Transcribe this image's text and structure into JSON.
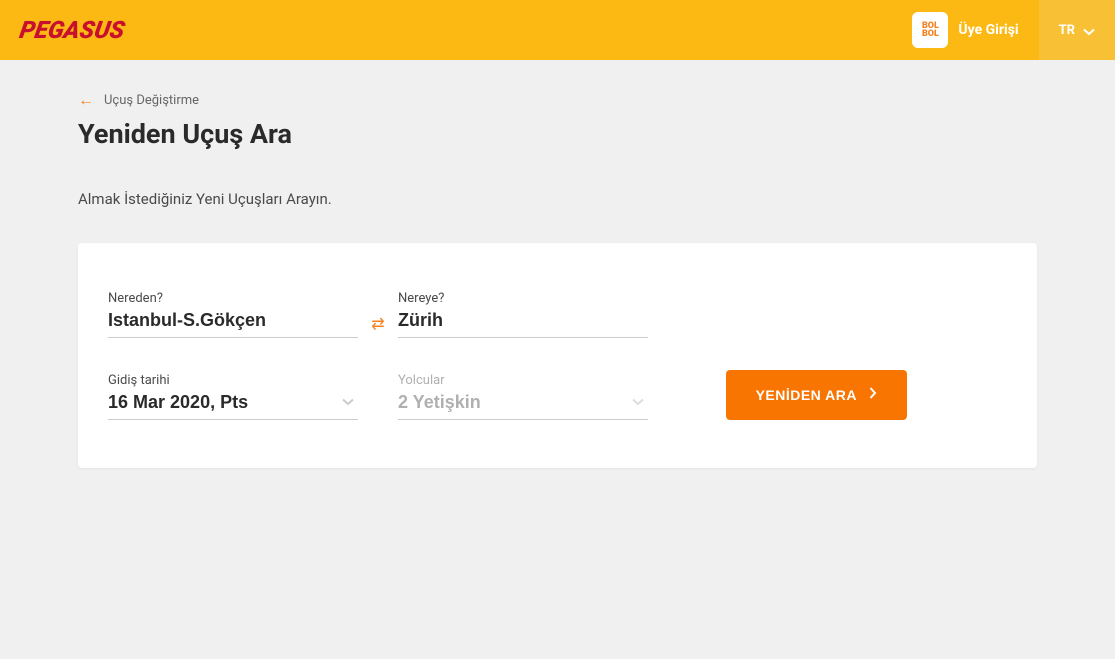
{
  "header": {
    "logo": "PEGASUS",
    "bolbol": "BOL BOL",
    "login": "Üye Girişi",
    "language": "TR"
  },
  "breadcrumb": {
    "label": "Uçuş Değiştirme"
  },
  "page": {
    "title": "Yeniden Uçuş Ara",
    "subtitle": "Almak İstediğiniz Yeni Uçuşları Arayın."
  },
  "search": {
    "from_label": "Nereden?",
    "from_value": "Istanbul-S.Gökçen",
    "to_label": "Nereye?",
    "to_value": "Zürih",
    "date_label": "Gidiş tarihi",
    "date_value": "16 Mar 2020, Pts",
    "passengers_label": "Yolcular",
    "passengers_value": "2 Yetişkin",
    "button_label": "YENİDEN ARA"
  }
}
